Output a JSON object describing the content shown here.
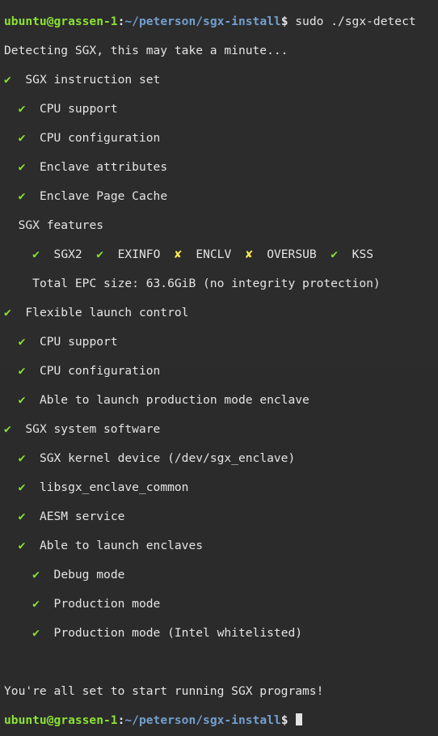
{
  "colors": {
    "background": "#2c2c2c",
    "text": "#e4e4e4",
    "prompt_user": "#8ae234",
    "prompt_path": "#729fcf",
    "check": "#8ae234",
    "cross": "#fce94f"
  },
  "prompt": {
    "user_host": "ubuntu@grassen-1",
    "colon": ":",
    "path": "~/peterson/sgx-install",
    "dollar": "$"
  },
  "command": " sudo ./sgx-detect",
  "symbols": {
    "check": "✔",
    "cross": "✘"
  },
  "output": {
    "detecting": "Detecting SGX, this may take a minute...",
    "sgx_instruction_set": "SGX instruction set",
    "cpu_support": "CPU support",
    "cpu_configuration": "CPU configuration",
    "enclave_attributes": "Enclave attributes",
    "enclave_page_cache": "Enclave Page Cache",
    "sgx_features": "SGX features",
    "features": {
      "sgx2": "SGX2",
      "exinfo": "EXINFO",
      "enclv": "ENCLV",
      "oversub": "OVERSUB",
      "kss": "KSS"
    },
    "total_epc": "Total EPC size: 63.6GiB (no integrity protection)",
    "flexible_launch_control": "Flexible launch control",
    "flc_cpu_support": "CPU support",
    "flc_cpu_configuration": "CPU configuration",
    "flc_able_production": "Able to launch production mode enclave",
    "sgx_system_software": "SGX system software",
    "sgx_kernel_device": "SGX kernel device (/dev/sgx_enclave)",
    "libsgx": "libsgx_enclave_common",
    "aesm": "AESM service",
    "able_launch_enclaves": "Able to launch enclaves",
    "debug_mode": "Debug mode",
    "production_mode": "Production mode",
    "production_mode_whitelisted": "Production mode (Intel whitelisted)",
    "all_set": "You're all set to start running SGX programs!"
  }
}
